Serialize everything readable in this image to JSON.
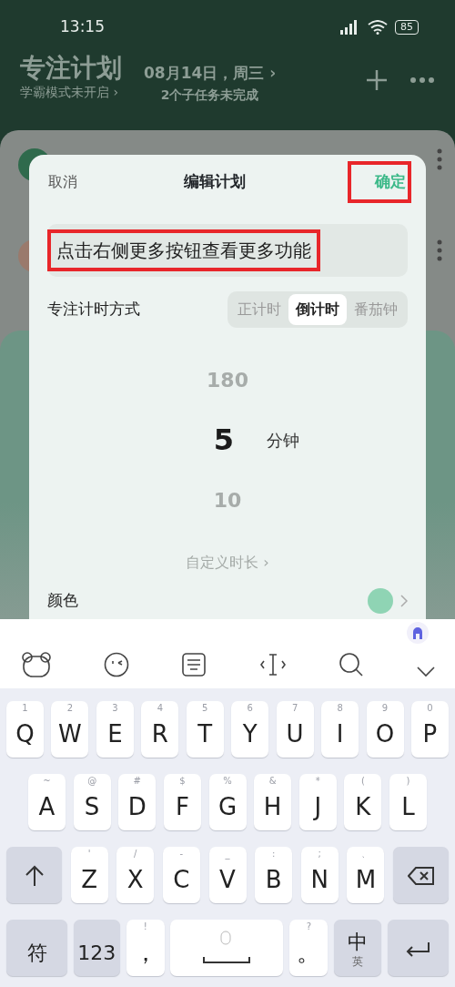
{
  "status_bar": {
    "time": "13:15",
    "battery": "85"
  },
  "header": {
    "title": "专注计划",
    "subtitle": "学霸模式未开启 ›",
    "date": "08月14日，周三 ›",
    "tasks_note": "2个子任务未完成"
  },
  "dialog": {
    "cancel": "取消",
    "title": "编辑计划",
    "confirm": {
      "label": "确定",
      "highlighted": true
    },
    "plan_name": {
      "value": "点击右侧更多按钮查看更多功能",
      "highlighted": true
    },
    "timer_mode": {
      "label": "专注计时方式",
      "options": [
        {
          "label": "正计时",
          "selected": false
        },
        {
          "label": "倒计时",
          "selected": true
        },
        {
          "label": "番茄钟",
          "selected": false
        }
      ]
    },
    "picker": {
      "values": [
        {
          "value": "180",
          "selected": false
        },
        {
          "value": "5",
          "selected": true
        },
        {
          "value": "10",
          "selected": false
        }
      ],
      "unit": "分钟"
    },
    "custom_duration": "自定义时长 ›",
    "color_row": {
      "label": "颜色",
      "color": "#8fd4b4"
    }
  },
  "keyboard": {
    "rows": [
      [
        {
          "kind": "letter",
          "label": "Q",
          "hint": "1"
        },
        {
          "kind": "letter",
          "label": "W",
          "hint": "2"
        },
        {
          "kind": "letter",
          "label": "E",
          "hint": "3"
        },
        {
          "kind": "letter",
          "label": "R",
          "hint": "4"
        },
        {
          "kind": "letter",
          "label": "T",
          "hint": "5"
        },
        {
          "kind": "letter",
          "label": "Y",
          "hint": "6"
        },
        {
          "kind": "letter",
          "label": "U",
          "hint": "7"
        },
        {
          "kind": "letter",
          "label": "I",
          "hint": "8"
        },
        {
          "kind": "letter",
          "label": "O",
          "hint": "9"
        },
        {
          "kind": "letter",
          "label": "P",
          "hint": "0"
        }
      ],
      [
        {
          "kind": "letter",
          "label": "A",
          "hint": "~"
        },
        {
          "kind": "letter",
          "label": "S",
          "hint": "@"
        },
        {
          "kind": "letter",
          "label": "D",
          "hint": "#"
        },
        {
          "kind": "letter",
          "label": "F",
          "hint": "$"
        },
        {
          "kind": "letter",
          "label": "G",
          "hint": "%"
        },
        {
          "kind": "letter",
          "label": "H",
          "hint": "&"
        },
        {
          "kind": "letter",
          "label": "J",
          "hint": "*"
        },
        {
          "kind": "letter",
          "label": "K",
          "hint": "("
        },
        {
          "kind": "letter",
          "label": "L",
          "hint": ")"
        }
      ],
      [
        {
          "kind": "shift"
        },
        {
          "kind": "letter",
          "label": "Z",
          "hint": "'"
        },
        {
          "kind": "letter",
          "label": "X",
          "hint": "/"
        },
        {
          "kind": "letter",
          "label": "C",
          "hint": "-"
        },
        {
          "kind": "letter",
          "label": "V",
          "hint": "_"
        },
        {
          "kind": "letter",
          "label": "B",
          "hint": ":"
        },
        {
          "kind": "letter",
          "label": "N",
          "hint": ";"
        },
        {
          "kind": "letter",
          "label": "M",
          "hint": "、"
        },
        {
          "kind": "delete"
        }
      ],
      [
        {
          "kind": "function",
          "label": "符"
        },
        {
          "kind": "function",
          "label": "123"
        },
        {
          "kind": "punct",
          "label": "，",
          "hint": "!"
        },
        {
          "kind": "space"
        },
        {
          "kind": "punct",
          "label": "。",
          "hint": "?"
        },
        {
          "kind": "lang",
          "label": "中",
          "hint": "英"
        },
        {
          "kind": "enter"
        }
      ]
    ]
  }
}
